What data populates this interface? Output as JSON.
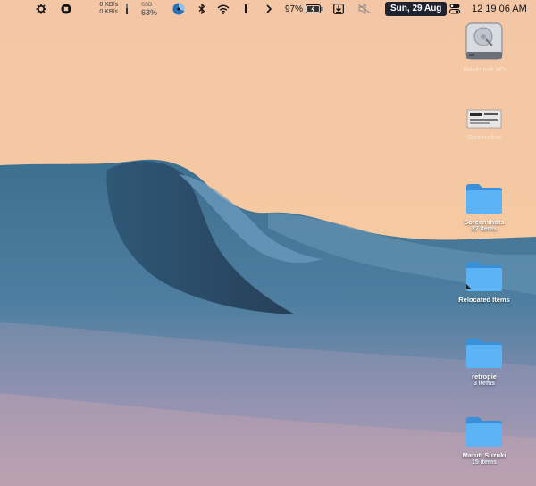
{
  "menubar": {
    "net_up": "0 KB/s",
    "net_down": "0 KB/s",
    "ssd_label": "SSD",
    "ssd_value": "63%",
    "battery_percent": "97%",
    "date": "Sun, 29 Aug",
    "time": "12 19 06 AM",
    "icons": [
      "gear-icon",
      "stop-icon",
      "stats-icon",
      "pie-chart-icon",
      "bluetooth-icon",
      "wifi-icon",
      "cursor-icon",
      "chevron-right-icon",
      "battery-icon",
      "download-icon",
      "mute-icon",
      "control-center-icon"
    ]
  },
  "desktop": {
    "items": [
      {
        "name": "Macintosh HD",
        "sub": "",
        "icon": "hard-drive-icon"
      },
      {
        "name": "Screenshot",
        "sub": "",
        "icon": "screenshot-icon"
      },
      {
        "name": "Screenshots",
        "sub": "27 items",
        "icon": "folder-icon"
      },
      {
        "name": "Relocated Items",
        "sub": "",
        "icon": "folder-alias-icon"
      },
      {
        "name": "retropie",
        "sub": "3 items",
        "icon": "folder-icon"
      },
      {
        "name": "Maruti Suzuki",
        "sub": "15 items",
        "icon": "folder-icon"
      }
    ]
  }
}
